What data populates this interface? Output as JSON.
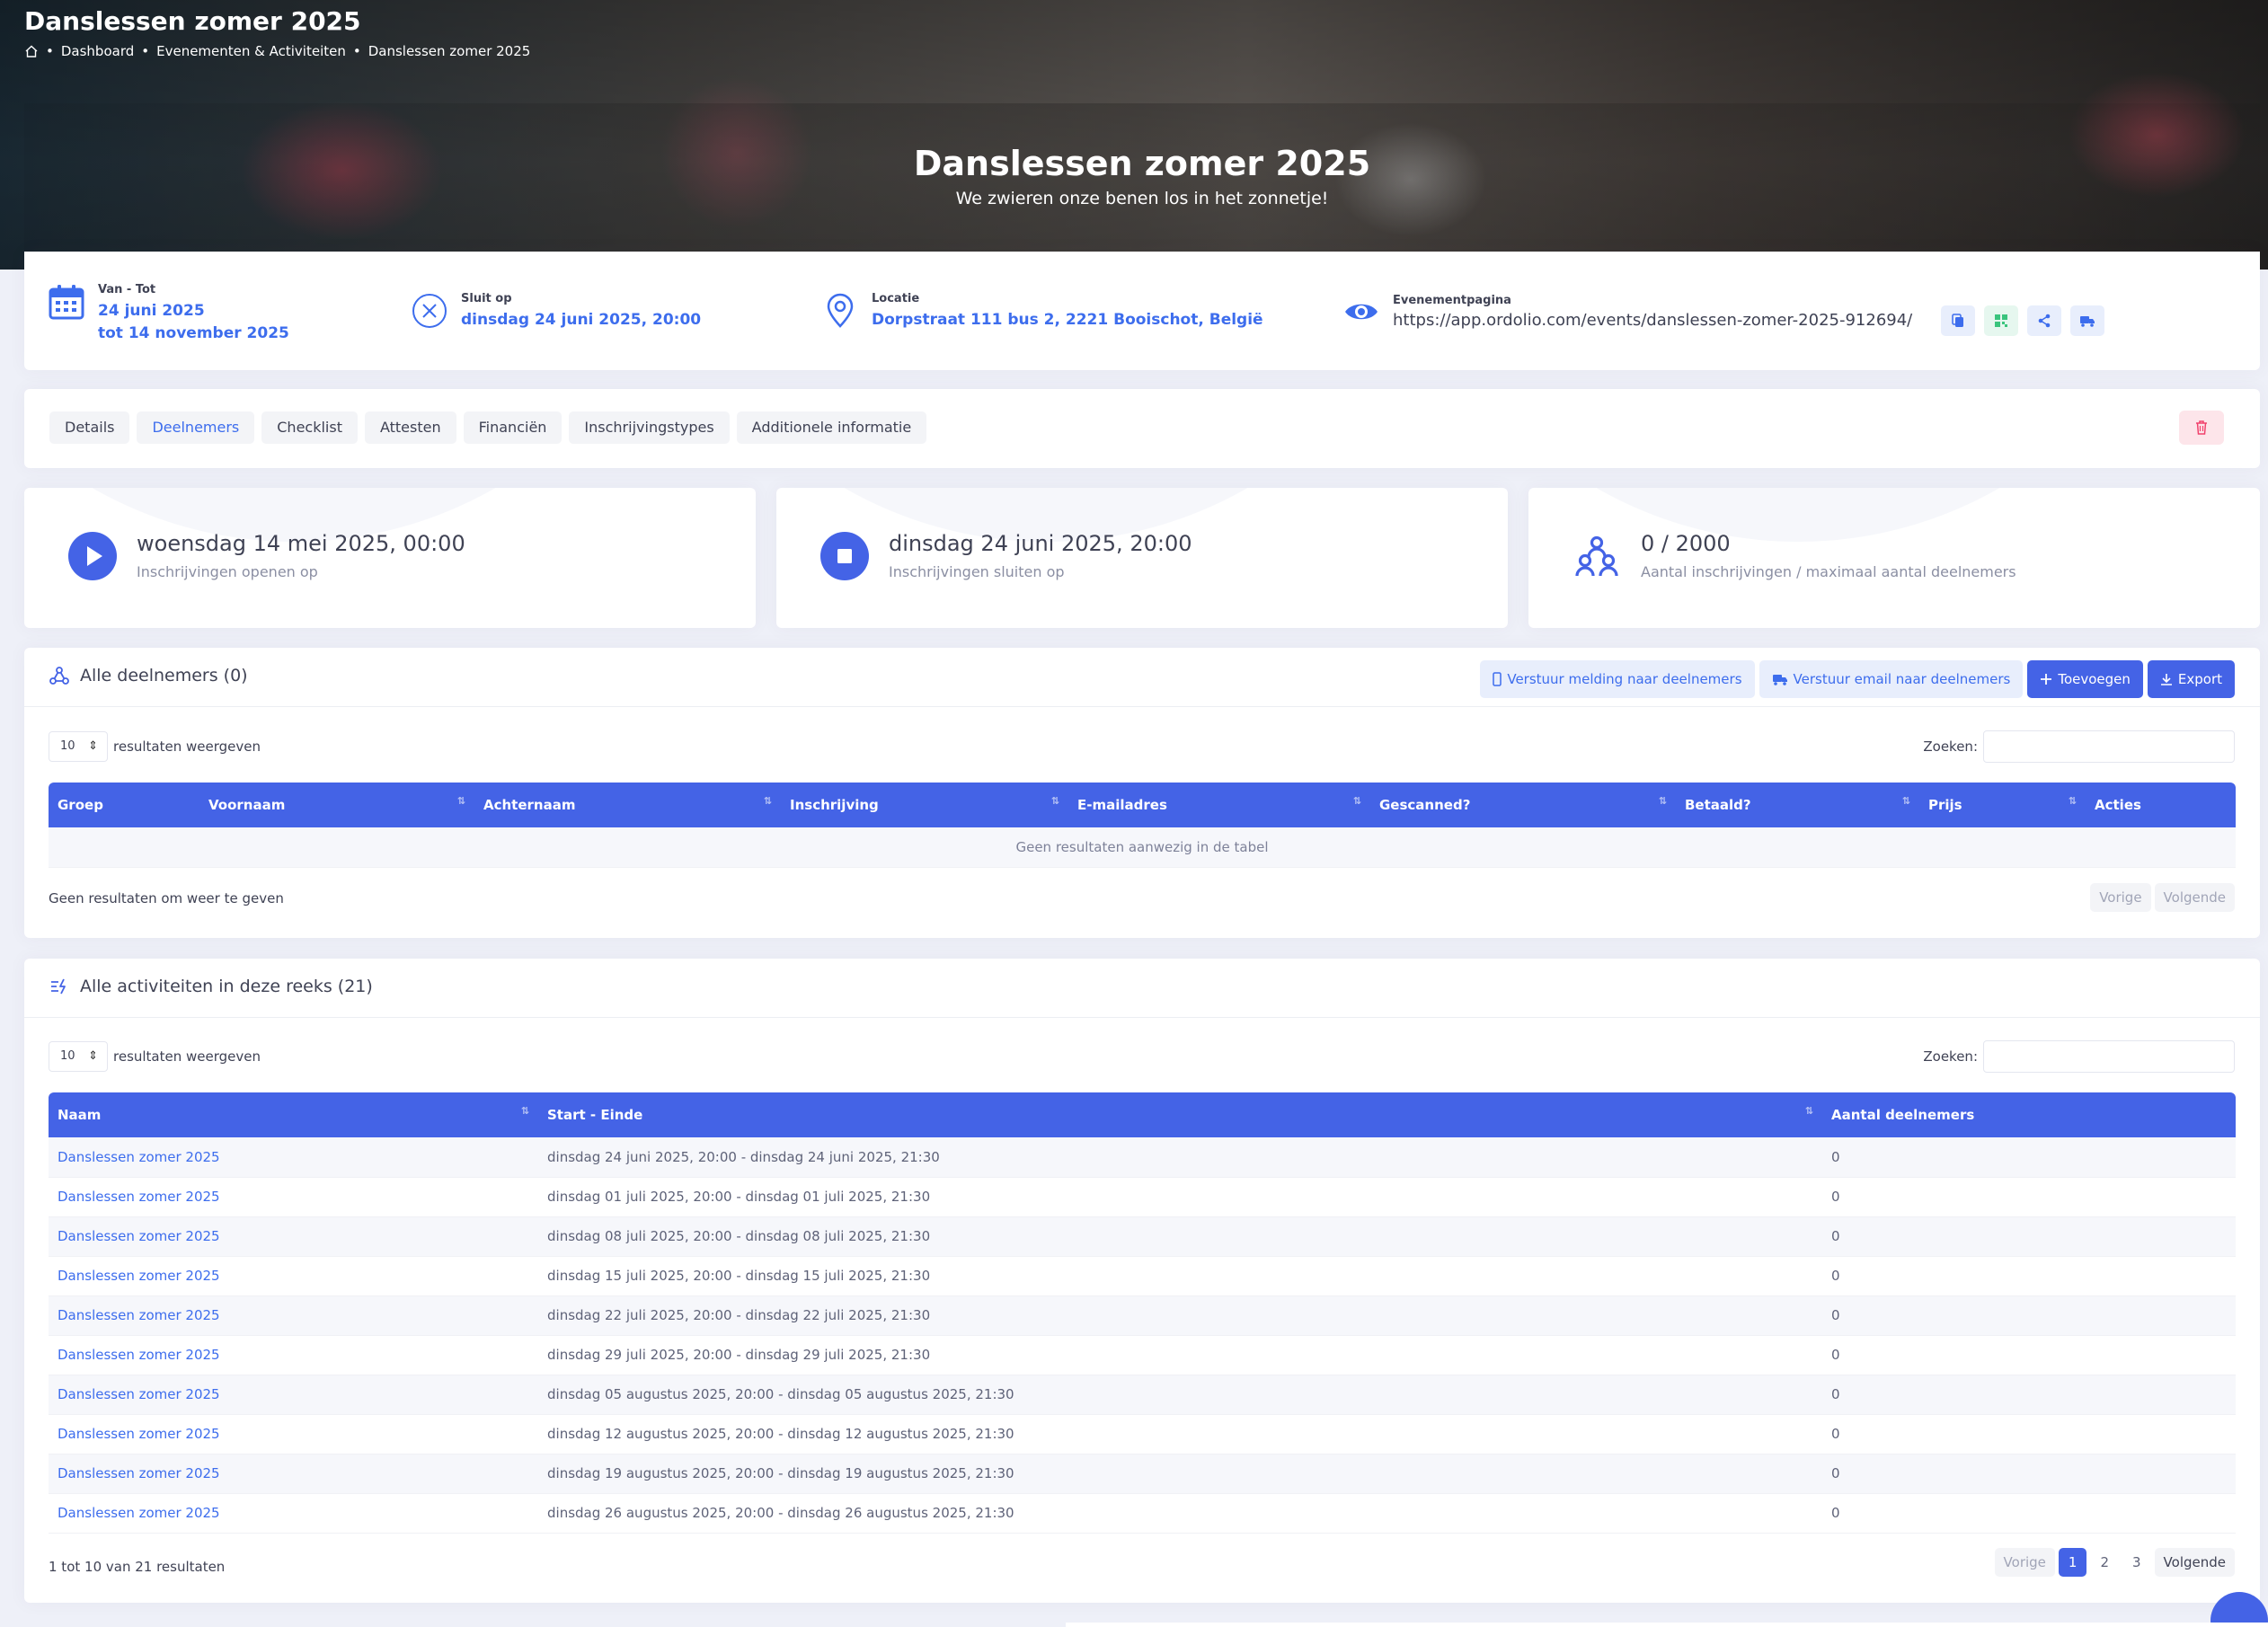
{
  "header": {
    "title": "Danslessen zomer 2025",
    "breadcrumb": [
      "Dashboard",
      "Evenementen & Activiteiten",
      "Danslessen zomer 2025"
    ]
  },
  "hero": {
    "title": "Danslessen zomer 2025",
    "subtitle": "We zwieren onze benen los in het zonnetje!"
  },
  "info": {
    "dates_label": "Van - Tot",
    "date_from": "24 juni 2025",
    "date_to": "tot 14 november 2025",
    "closes_label": "Sluit op",
    "closes_value": "dinsdag 24 juni 2025, 20:00",
    "location_label": "Locatie",
    "location_value": "Dorpstraat 111 bus 2, 2221 Booischot, België",
    "eventpage_label": "Evenementpagina",
    "eventpage_url": "https://app.ordolio.com/events/danslessen-zomer-2025-912694/"
  },
  "tabs": [
    "Details",
    "Deelnemers",
    "Checklist",
    "Attesten",
    "Financiën",
    "Inschrijvingstypes",
    "Additionele informatie"
  ],
  "active_tab": "Deelnemers",
  "stats": [
    {
      "value": "woensdag 14 mei 2025, 00:00",
      "label": "Inschrijvingen openen op",
      "icon": "play-icon"
    },
    {
      "value": "dinsdag 24 juni 2025, 20:00",
      "label": "Inschrijvingen sluiten op",
      "icon": "stop-icon"
    },
    {
      "value": "0 / 2000",
      "label": "Aantal inschrijvingen / maximaal aantal deelnemers",
      "icon": "users-icon"
    }
  ],
  "participants": {
    "title": "Alle deelnemers (0)",
    "btn_notify": "Verstuur melding naar deelnemers",
    "btn_email": "Verstuur email naar deelnemers",
    "btn_add": "Toevoegen",
    "btn_export": "Export",
    "length_value": "10",
    "length_label": "resultaten weergeven",
    "search_label": "Zoeken:",
    "columns": [
      "Groep",
      "Voornaam",
      "Achternaam",
      "Inschrijving",
      "E-mailadres",
      "Gescanned?",
      "Betaald?",
      "Prijs",
      "Acties"
    ],
    "empty": "Geen resultaten aanwezig in de tabel",
    "info": "Geen resultaten om weer te geven",
    "prev": "Vorige",
    "next": "Volgende"
  },
  "activities": {
    "title": "Alle activiteiten in deze reeks (21)",
    "length_value": "10",
    "length_label": "resultaten weergeven",
    "search_label": "Zoeken:",
    "columns": [
      "Naam",
      "Start - Einde",
      "Aantal deelnemers"
    ],
    "rows": [
      {
        "name": "Danslessen zomer 2025",
        "range": "dinsdag 24 juni 2025, 20:00 - dinsdag 24 juni 2025, 21:30",
        "count": "0"
      },
      {
        "name": "Danslessen zomer 2025",
        "range": "dinsdag 01 juli 2025, 20:00 - dinsdag 01 juli 2025, 21:30",
        "count": "0"
      },
      {
        "name": "Danslessen zomer 2025",
        "range": "dinsdag 08 juli 2025, 20:00 - dinsdag 08 juli 2025, 21:30",
        "count": "0"
      },
      {
        "name": "Danslessen zomer 2025",
        "range": "dinsdag 15 juli 2025, 20:00 - dinsdag 15 juli 2025, 21:30",
        "count": "0"
      },
      {
        "name": "Danslessen zomer 2025",
        "range": "dinsdag 22 juli 2025, 20:00 - dinsdag 22 juli 2025, 21:30",
        "count": "0"
      },
      {
        "name": "Danslessen zomer 2025",
        "range": "dinsdag 29 juli 2025, 20:00 - dinsdag 29 juli 2025, 21:30",
        "count": "0"
      },
      {
        "name": "Danslessen zomer 2025",
        "range": "dinsdag 05 augustus 2025, 20:00 - dinsdag 05 augustus 2025, 21:30",
        "count": "0"
      },
      {
        "name": "Danslessen zomer 2025",
        "range": "dinsdag 12 augustus 2025, 20:00 - dinsdag 12 augustus 2025, 21:30",
        "count": "0"
      },
      {
        "name": "Danslessen zomer 2025",
        "range": "dinsdag 19 augustus 2025, 20:00 - dinsdag 19 augustus 2025, 21:30",
        "count": "0"
      },
      {
        "name": "Danslessen zomer 2025",
        "range": "dinsdag 26 augustus 2025, 20:00 - dinsdag 26 augustus 2025, 21:30",
        "count": "0"
      }
    ],
    "info": "1 tot 10 van 21 resultaten",
    "prev": "Vorige",
    "pages": [
      "1",
      "2",
      "3"
    ],
    "current_page": "1",
    "next": "Volgende"
  },
  "colors": {
    "primary": "#4463e6",
    "accent_text": "#3d6ded",
    "danger_light": "#fde5ea"
  }
}
